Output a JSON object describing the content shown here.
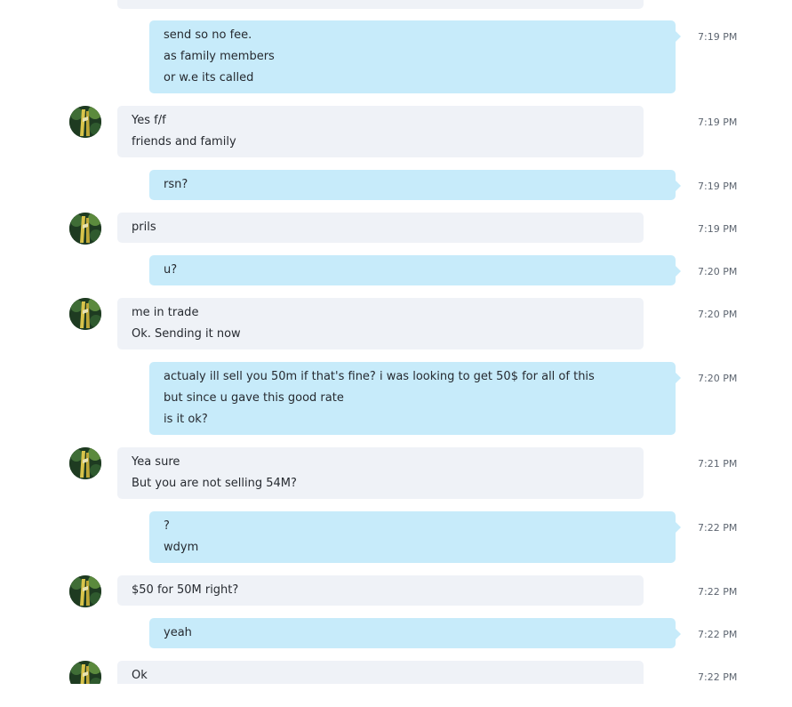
{
  "messages": [
    {
      "dir": "in",
      "lines": [],
      "time": ""
    },
    {
      "dir": "out",
      "lines": [
        "send so no fee.",
        "as family members",
        "or w.e its called"
      ],
      "time": "7:19 PM"
    },
    {
      "dir": "in",
      "lines": [
        "Yes f/f",
        "friends and family"
      ],
      "time": "7:19 PM"
    },
    {
      "dir": "out",
      "lines": [
        "rsn?"
      ],
      "time": "7:19 PM"
    },
    {
      "dir": "in",
      "lines": [
        "prils"
      ],
      "time": "7:19 PM"
    },
    {
      "dir": "out",
      "lines": [
        "u?"
      ],
      "time": "7:20 PM"
    },
    {
      "dir": "in",
      "lines": [
        "me in trade",
        "Ok. Sending it now"
      ],
      "time": "7:20 PM"
    },
    {
      "dir": "out",
      "lines": [
        "actualy ill sell you 50m if that's fine? i was looking to get 50$ for all of this",
        "but since u gave this good rate",
        "is it ok?"
      ],
      "time": "7:20 PM"
    },
    {
      "dir": "in",
      "lines": [
        "Yea sure",
        "But you are not selling 54M?"
      ],
      "time": "7:21 PM"
    },
    {
      "dir": "out",
      "lines": [
        "?",
        "wdym"
      ],
      "time": "7:22 PM"
    },
    {
      "dir": "in",
      "lines": [
        "$50 for 50M right?"
      ],
      "time": "7:22 PM"
    },
    {
      "dir": "out",
      "lines": [
        "yeah"
      ],
      "time": "7:22 PM"
    },
    {
      "dir": "in",
      "lines": [
        "Ok"
      ],
      "time": "7:22 PM"
    }
  ],
  "colors": {
    "incoming_bubble": "#eff2f7",
    "outgoing_bubble": "#c7ebfa",
    "text": "#262a30",
    "timestamp": "#5d6570"
  },
  "avatar_icon": "contact-avatar-icon"
}
